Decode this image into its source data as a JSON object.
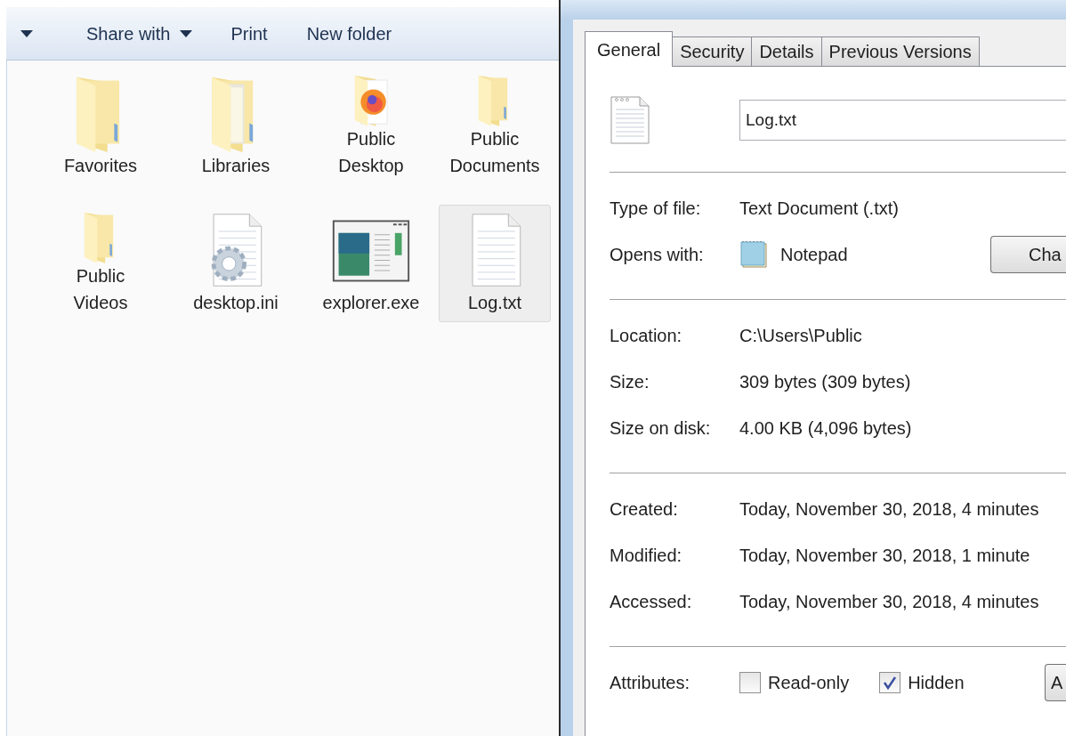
{
  "explorer": {
    "toolbar": [
      {
        "label": "Share with",
        "dropdown": true
      },
      {
        "label": "Print",
        "dropdown": false
      },
      {
        "label": "New folder",
        "dropdown": false
      }
    ],
    "items": [
      {
        "name": "Favorites",
        "kind": "folder",
        "selected": false
      },
      {
        "name": "Libraries",
        "kind": "library",
        "selected": false
      },
      {
        "name": "Public Desktop",
        "kind": "browser-folder",
        "selected": false
      },
      {
        "name": "Public Documents",
        "kind": "folder",
        "selected": false
      },
      {
        "name": "Public Videos",
        "kind": "folder",
        "selected": false
      },
      {
        "name": "desktop.ini",
        "kind": "settings-file",
        "selected": false
      },
      {
        "name": "explorer.exe",
        "kind": "program",
        "selected": false
      },
      {
        "name": "Log.txt",
        "kind": "text-file",
        "selected": true
      }
    ]
  },
  "dialog": {
    "tabs": [
      {
        "label": "General",
        "selected": true
      },
      {
        "label": "Security",
        "selected": false
      },
      {
        "label": "Details",
        "selected": false
      },
      {
        "label": "Previous Versions",
        "selected": false
      }
    ],
    "file_name": "Log.txt",
    "sections": [
      [
        {
          "kind": "text",
          "label": "Type of file:",
          "value": "Text Document (.txt)"
        },
        {
          "kind": "app",
          "label": "Opens with:",
          "value": "Notepad",
          "button": "Cha"
        }
      ],
      [
        {
          "kind": "text",
          "label": "Location:",
          "value": "C:\\Users\\Public"
        },
        {
          "kind": "text",
          "label": "Size:",
          "value": "309 bytes (309 bytes)"
        },
        {
          "kind": "text",
          "label": "Size on disk:",
          "value": "4.00 KB (4,096 bytes)"
        }
      ],
      [
        {
          "kind": "text",
          "label": "Created:",
          "value": "Today, November 30, 2018, 4 minutes"
        },
        {
          "kind": "text",
          "label": "Modified:",
          "value": "Today, November 30, 2018, 1 minute"
        },
        {
          "kind": "text",
          "label": "Accessed:",
          "value": "Today, November 30, 2018, 4 minutes"
        }
      ],
      [
        {
          "kind": "attributes",
          "label": "Attributes:",
          "checkboxes": [
            {
              "label": "Read-only",
              "checked": false
            },
            {
              "label": "Hidden",
              "checked": true
            }
          ],
          "button": "A"
        }
      ]
    ]
  }
}
